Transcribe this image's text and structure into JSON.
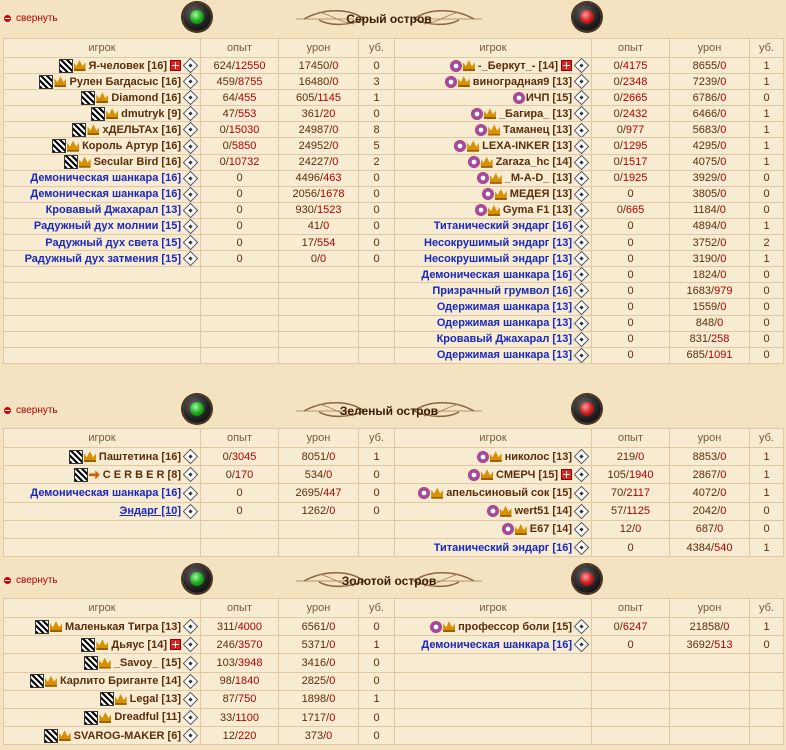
{
  "headers": {
    "player": "игрок",
    "exp": "опыт",
    "dmg": "урон",
    "kills": "уб."
  },
  "collapse_label": "свернуть",
  "sections": [
    {
      "title": "Серый остров",
      "left": [
        {
          "icons": [
            "chess",
            "crown"
          ],
          "name": "Я-человек [16]",
          "bot": false,
          "plus": true,
          "exp_a": "624",
          "exp_b": "12550",
          "dmg_a": "17450",
          "dmg_b": "0",
          "kills": "0"
        },
        {
          "icons": [
            "chess",
            "crown"
          ],
          "name": "Рулен Багдасыс [16]",
          "bot": false,
          "plus": false,
          "exp_a": "459",
          "exp_b": "8755",
          "dmg_a": "16480",
          "dmg_b": "0",
          "kills": "3"
        },
        {
          "icons": [
            "chess",
            "crown"
          ],
          "name": "Diamond [16]",
          "bot": false,
          "plus": false,
          "exp_a": "64",
          "exp_b": "455",
          "dmg_a": "605",
          "dmg_b": "1145",
          "kills": "1"
        },
        {
          "icons": [
            "chess",
            "crown"
          ],
          "name": "dmutryk [9]",
          "bot": false,
          "plus": false,
          "exp_a": "47",
          "exp_b": "553",
          "dmg_a": "361",
          "dmg_b": "20",
          "kills": "0"
        },
        {
          "icons": [
            "chess",
            "crown"
          ],
          "name": "хДЕЛЬТАх [16]",
          "bot": false,
          "plus": false,
          "exp_a": "0",
          "exp_b": "15030",
          "dmg_a": "24987",
          "dmg_b": "0",
          "kills": "8"
        },
        {
          "icons": [
            "chess",
            "crown"
          ],
          "name": "Король Артур [16]",
          "bot": false,
          "plus": false,
          "exp_a": "0",
          "exp_b": "5850",
          "dmg_a": "24952",
          "dmg_b": "0",
          "kills": "5"
        },
        {
          "icons": [
            "chess",
            "crown"
          ],
          "name": "Secular Bird [16]",
          "bot": false,
          "plus": false,
          "exp_a": "0",
          "exp_b": "10732",
          "dmg_a": "24227",
          "dmg_b": "0",
          "kills": "2"
        },
        {
          "icons": [],
          "name": "Демоническая шанкара [16]",
          "bot": true,
          "plus": false,
          "exp_a": "0",
          "exp_b": "",
          "dmg_a": "4496",
          "dmg_b": "463",
          "kills": "0"
        },
        {
          "icons": [],
          "name": "Демоническая шанкара [16]",
          "bot": true,
          "plus": false,
          "exp_a": "0",
          "exp_b": "",
          "dmg_a": "2056",
          "dmg_b": "1678",
          "kills": "0"
        },
        {
          "icons": [],
          "name": "Кровавый Джахарал [13]",
          "bot": true,
          "plus": false,
          "exp_a": "0",
          "exp_b": "",
          "dmg_a": "930",
          "dmg_b": "1523",
          "kills": "0"
        },
        {
          "icons": [],
          "name": "Радужный дух молнии  [15]",
          "bot": true,
          "plus": false,
          "exp_a": "0",
          "exp_b": "",
          "dmg_a": "41",
          "dmg_b": "0",
          "kills": "0"
        },
        {
          "icons": [],
          "name": "Радужный дух света  [15]",
          "bot": true,
          "plus": false,
          "exp_a": "0",
          "exp_b": "",
          "dmg_a": "17",
          "dmg_b": "554",
          "kills": "0"
        },
        {
          "icons": [],
          "name": "Радужный дух затмения  [15]",
          "bot": true,
          "plus": false,
          "exp_a": "0",
          "exp_b": "",
          "dmg_a": "0",
          "dmg_b": "0",
          "kills": "0"
        }
      ],
      "right": [
        {
          "icons": [
            "snow",
            "crown"
          ],
          "name": "-_Беркут_- [14]",
          "bot": false,
          "plus": true,
          "exp_a": "0",
          "exp_b": "4175",
          "dmg_a": "8655",
          "dmg_b": "0",
          "kills": "1"
        },
        {
          "icons": [
            "snow",
            "crown"
          ],
          "name": "виноградная9 [13]",
          "bot": false,
          "plus": false,
          "exp_a": "0",
          "exp_b": "2348",
          "dmg_a": "7239",
          "dmg_b": "0",
          "kills": "1"
        },
        {
          "icons": [
            "snow"
          ],
          "name": "ИЧП [15]",
          "bot": false,
          "plus": false,
          "exp_a": "0",
          "exp_b": "2665",
          "dmg_a": "6786",
          "dmg_b": "0",
          "kills": "0"
        },
        {
          "icons": [
            "snow",
            "crown"
          ],
          "name": "_Багира_ [13]",
          "bot": false,
          "plus": false,
          "exp_a": "0",
          "exp_b": "2432",
          "dmg_a": "6466",
          "dmg_b": "0",
          "kills": "1"
        },
        {
          "icons": [
            "snow",
            "crown"
          ],
          "name": "Таманец [13]",
          "bot": false,
          "plus": false,
          "exp_a": "0",
          "exp_b": "977",
          "dmg_a": "5683",
          "dmg_b": "0",
          "kills": "1"
        },
        {
          "icons": [
            "snow",
            "crown"
          ],
          "name": "LEXA-INKER [13]",
          "bot": false,
          "plus": false,
          "exp_a": "0",
          "exp_b": "1295",
          "dmg_a": "4295",
          "dmg_b": "0",
          "kills": "1"
        },
        {
          "icons": [
            "snow",
            "crown"
          ],
          "name": "Zaraza_hc [14]",
          "bot": false,
          "plus": false,
          "exp_a": "0",
          "exp_b": "1517",
          "dmg_a": "4075",
          "dmg_b": "0",
          "kills": "1"
        },
        {
          "icons": [
            "snow",
            "crown"
          ],
          "name": "_M-A-D_ [13]",
          "bot": false,
          "plus": false,
          "exp_a": "0",
          "exp_b": "1925",
          "dmg_a": "3929",
          "dmg_b": "0",
          "kills": "0"
        },
        {
          "icons": [
            "snow",
            "crown"
          ],
          "name": "МЕДЕЯ [13]",
          "bot": false,
          "plus": false,
          "exp_a": "0",
          "exp_b": "",
          "dmg_a": "3805",
          "dmg_b": "0",
          "kills": "0"
        },
        {
          "icons": [
            "snow",
            "crown"
          ],
          "name": "Gyma F1 [13]",
          "bot": false,
          "plus": false,
          "exp_a": "0",
          "exp_b": "665",
          "dmg_a": "1184",
          "dmg_b": "0",
          "kills": "0"
        },
        {
          "icons": [],
          "name": "Титанический эндарг [16]",
          "bot": true,
          "plus": false,
          "exp_a": "0",
          "exp_b": "",
          "dmg_a": "4894",
          "dmg_b": "0",
          "kills": "1"
        },
        {
          "icons": [],
          "name": "Несокрушимый эндарг [13]",
          "bot": true,
          "plus": false,
          "exp_a": "0",
          "exp_b": "",
          "dmg_a": "3752",
          "dmg_b": "0",
          "kills": "2"
        },
        {
          "icons": [],
          "name": "Несокрушимый эндарг [13]",
          "bot": true,
          "plus": false,
          "exp_a": "0",
          "exp_b": "",
          "dmg_a": "3190",
          "dmg_b": "0",
          "kills": "1"
        },
        {
          "icons": [],
          "name": "Демоническая шанкара [16]",
          "bot": true,
          "plus": false,
          "exp_a": "0",
          "exp_b": "",
          "dmg_a": "1824",
          "dmg_b": "0",
          "kills": "0"
        },
        {
          "icons": [],
          "name": "Призрачный грумвол [16]",
          "bot": true,
          "plus": false,
          "exp_a": "0",
          "exp_b": "",
          "dmg_a": "1683",
          "dmg_b": "979",
          "kills": "0"
        },
        {
          "icons": [],
          "name": "Одержимая шанкара [13]",
          "bot": true,
          "plus": false,
          "exp_a": "0",
          "exp_b": "",
          "dmg_a": "1559",
          "dmg_b": "0",
          "kills": "0"
        },
        {
          "icons": [],
          "name": "Одержимая шанкара [13]",
          "bot": true,
          "plus": false,
          "exp_a": "0",
          "exp_b": "",
          "dmg_a": "848",
          "dmg_b": "0",
          "kills": "0"
        },
        {
          "icons": [],
          "name": "Кровавый Джахарал [13]",
          "bot": true,
          "plus": false,
          "exp_a": "0",
          "exp_b": "",
          "dmg_a": "831",
          "dmg_b": "258",
          "kills": "0"
        },
        {
          "icons": [],
          "name": "Одержимая шанкара [13]",
          "bot": true,
          "plus": false,
          "exp_a": "0",
          "exp_b": "",
          "dmg_a": "685",
          "dmg_b": "1091",
          "kills": "0"
        }
      ]
    },
    {
      "title": "Зеленый остров",
      "left": [
        {
          "icons": [
            "chess",
            "crown"
          ],
          "name": "Паштетина [16]",
          "bot": false,
          "plus": false,
          "exp_a": "0",
          "exp_b": "3045",
          "dmg_a": "8051",
          "dmg_b": "0",
          "kills": "1"
        },
        {
          "icons": [
            "chess",
            "arrow"
          ],
          "name": "C E R B E R [8]",
          "bot": false,
          "plus": false,
          "exp_a": "0",
          "exp_b": "170",
          "dmg_a": "534",
          "dmg_b": "0",
          "kills": "0"
        },
        {
          "icons": [],
          "name": "Демоническая шанкара [16]",
          "bot": true,
          "plus": false,
          "exp_a": "0",
          "exp_b": "",
          "dmg_a": "2695",
          "dmg_b": "447",
          "kills": "0"
        },
        {
          "icons": [],
          "name": "Эндарг [10]",
          "bot": true,
          "link": true,
          "plus": false,
          "exp_a": "0",
          "exp_b": "",
          "dmg_a": "1262",
          "dmg_b": "0",
          "kills": "0"
        }
      ],
      "right": [
        {
          "icons": [
            "snow",
            "crown"
          ],
          "name": "николос [13]",
          "bot": false,
          "plus": false,
          "exp_a": "219",
          "exp_b": "0",
          "dmg_a": "8853",
          "dmg_b": "0",
          "kills": "1"
        },
        {
          "icons": [
            "snow",
            "crown"
          ],
          "name": "СМЕРЧ [15]",
          "bot": false,
          "plus": true,
          "exp_a": "105",
          "exp_b": "1940",
          "dmg_a": "2867",
          "dmg_b": "0",
          "kills": "1"
        },
        {
          "icons": [
            "snow",
            "crown"
          ],
          "name": "апельсиновый сок [15]",
          "bot": false,
          "plus": false,
          "exp_a": "70",
          "exp_b": "2117",
          "dmg_a": "4072",
          "dmg_b": "0",
          "kills": "1"
        },
        {
          "icons": [
            "snow",
            "crown"
          ],
          "name": "wert51 [14]",
          "bot": false,
          "plus": false,
          "exp_a": "57",
          "exp_b": "1125",
          "dmg_a": "2042",
          "dmg_b": "0",
          "kills": "0"
        },
        {
          "icons": [
            "snow",
            "crown"
          ],
          "name": "E67 [14]",
          "bot": false,
          "plus": false,
          "exp_a": "12",
          "exp_b": "0",
          "dmg_a": "687",
          "dmg_b": "0",
          "kills": "0"
        },
        {
          "icons": [],
          "name": "Титанический эндарг [16]",
          "bot": true,
          "plus": false,
          "exp_a": "0",
          "exp_b": "",
          "dmg_a": "4384",
          "dmg_b": "540",
          "kills": "1"
        }
      ]
    },
    {
      "title": "Золотой остров",
      "left": [
        {
          "icons": [
            "chess",
            "crown"
          ],
          "name": "Маленькая Тигра [13]",
          "bot": false,
          "plus": false,
          "exp_a": "311",
          "exp_b": "4000",
          "dmg_a": "6561",
          "dmg_b": "0",
          "kills": "0"
        },
        {
          "icons": [
            "chess",
            "crown"
          ],
          "name": "Дьяус [14]",
          "bot": false,
          "plus": true,
          "exp_a": "246",
          "exp_b": "3570",
          "dmg_a": "5371",
          "dmg_b": "0",
          "kills": "1"
        },
        {
          "icons": [
            "chess",
            "crown"
          ],
          "name": "_Savoy_ [15]",
          "bot": false,
          "plus": false,
          "exp_a": "103",
          "exp_b": "3948",
          "dmg_a": "3416",
          "dmg_b": "0",
          "kills": "0"
        },
        {
          "icons": [
            "chess",
            "crown"
          ],
          "name": "Карлито Бриганте [14]",
          "bot": false,
          "plus": false,
          "exp_a": "98",
          "exp_b": "1840",
          "dmg_a": "2825",
          "dmg_b": "0",
          "kills": "0"
        },
        {
          "icons": [
            "chess",
            "crown"
          ],
          "name": "Legal [13]",
          "bot": false,
          "plus": false,
          "exp_a": "87",
          "exp_b": "750",
          "dmg_a": "1898",
          "dmg_b": "0",
          "kills": "1"
        },
        {
          "icons": [
            "chess",
            "crown"
          ],
          "name": "Dreadful [11]",
          "bot": false,
          "plus": false,
          "exp_a": "33",
          "exp_b": "1100",
          "dmg_a": "1717",
          "dmg_b": "0",
          "kills": "0"
        },
        {
          "icons": [
            "chess",
            "crown"
          ],
          "name": "SVAROG-MAKER [6]",
          "bot": false,
          "plus": false,
          "exp_a": "12",
          "exp_b": "220",
          "dmg_a": "373",
          "dmg_b": "0",
          "kills": "0"
        }
      ],
      "right": [
        {
          "icons": [
            "snow",
            "crown"
          ],
          "name": "профессор боли [15]",
          "bot": false,
          "plus": false,
          "exp_a": "0",
          "exp_b": "6247",
          "dmg_a": "21858",
          "dmg_b": "0",
          "kills": "1"
        },
        {
          "icons": [],
          "name": "Демоническая шанкара [16]",
          "bot": true,
          "plus": false,
          "exp_a": "0",
          "exp_b": "",
          "dmg_a": "3692",
          "dmg_b": "513",
          "kills": "0"
        }
      ]
    }
  ]
}
